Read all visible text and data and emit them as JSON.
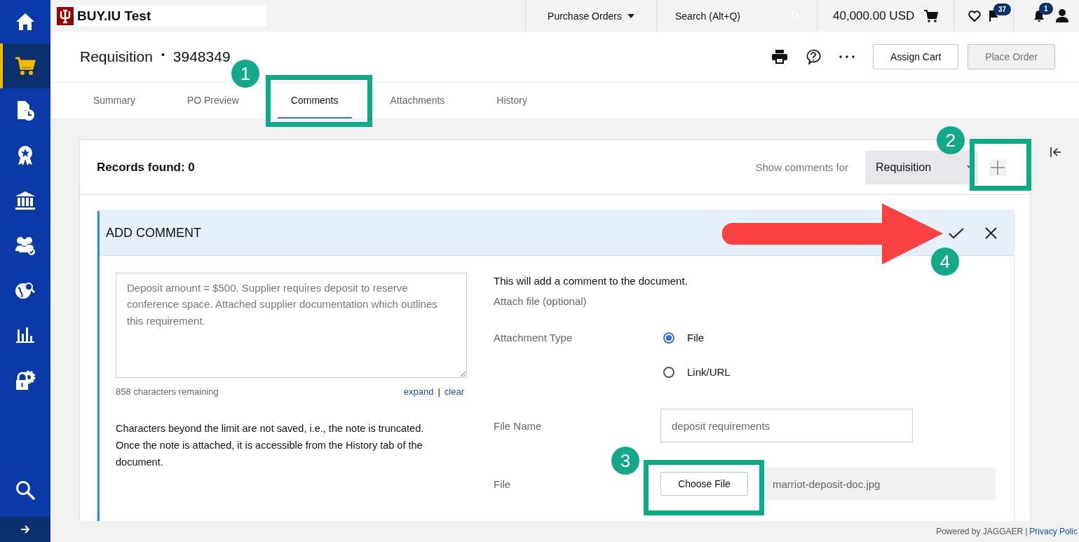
{
  "sidebar": {
    "items": [
      {
        "kind": "home",
        "selected": false
      },
      {
        "kind": "cart",
        "selected": true
      },
      {
        "kind": "document-clock",
        "selected": false
      },
      {
        "kind": "award",
        "selected": false
      },
      {
        "kind": "bank",
        "selected": false
      },
      {
        "kind": "users-check",
        "selected": false
      },
      {
        "kind": "globe-search",
        "selected": false
      },
      {
        "kind": "bar-chart",
        "selected": false
      },
      {
        "kind": "lock-gear",
        "selected": false
      }
    ]
  },
  "topbar": {
    "logo_text": "BUY.IU Test",
    "menu": "Purchase Orders",
    "search": {
      "placeholder": "Search (Alt+Q)"
    },
    "cart_total": "40,000.00 USD",
    "flag_count": "37",
    "notification_count": "1"
  },
  "header": {
    "title": "Requisition",
    "separator": "•",
    "number": "3948349",
    "buttons": [
      {
        "label": "Assign Cart",
        "disabled": false
      },
      {
        "label": "Place Order",
        "disabled": true
      }
    ]
  },
  "tabs": [
    {
      "label": "Summary",
      "selected": false
    },
    {
      "label": "PO Preview",
      "selected": false
    },
    {
      "label": "Comments",
      "selected": true
    },
    {
      "label": "Attachments",
      "selected": false
    },
    {
      "label": "History",
      "selected": false
    }
  ],
  "comments": {
    "records": "Records found: 0",
    "filter_label": "Show comments for",
    "filter_value": "Requisition"
  },
  "add_comment": {
    "title": "ADD COMMENT",
    "comment_text": "Deposit amount = $500. Supplier requires deposit to reserve conference space. Attached supplier documentation which outlines this requirement.",
    "remaining": "858 characters remaining",
    "links": [
      "expand",
      "clear"
    ],
    "link_separator": "|",
    "note": "Characters beyond the limit are not saved, i.e., the note is truncated. Once the note is attached, it is accessible from the History tab of the document.",
    "info": "This will add a comment to the document.",
    "attach_hint": "Attach file (optional)",
    "attachment_type_label": "Attachment Type",
    "attachment_types": [
      {
        "label": "File",
        "selected": true
      },
      {
        "label": "Link/URL",
        "selected": false
      }
    ],
    "file_name_label": "File Name",
    "file_name": "deposit requirements",
    "file_label": "File",
    "choose_button": "Choose File",
    "chosen_file": "marriot-deposit-doc.jpg"
  },
  "footer": {
    "powered_by": "Powered by JAGGAER",
    "separator": "|",
    "link": "Privacy Polic"
  },
  "annotations": {
    "steps": [
      "1",
      "2",
      "3",
      "4"
    ]
  }
}
